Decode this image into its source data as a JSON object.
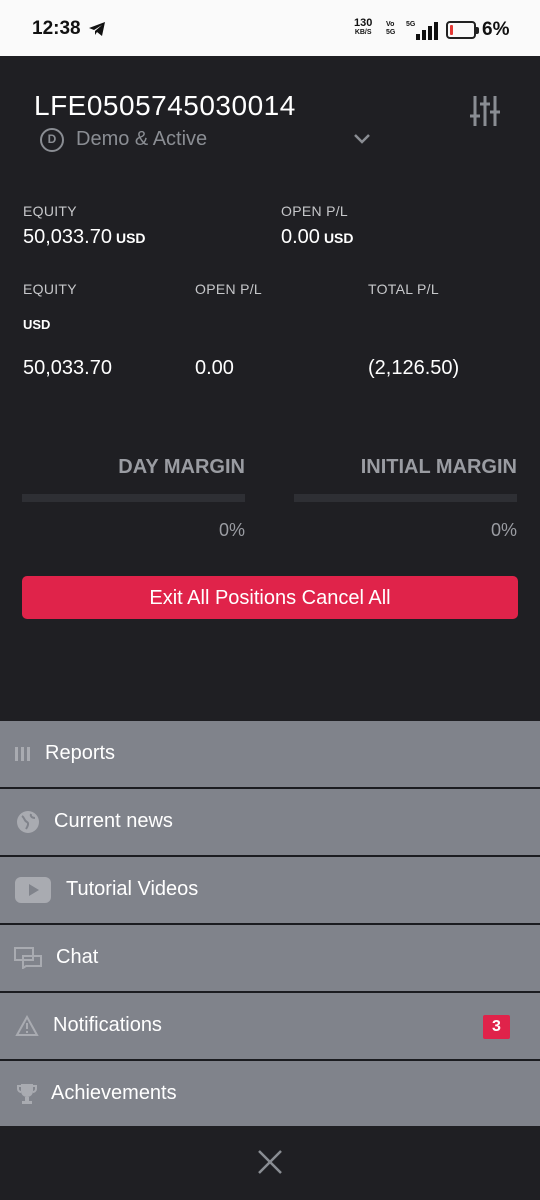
{
  "status_bar": {
    "time": "12:38",
    "net_speed": "130",
    "net_unit": "KB/S",
    "volte_top": "Vo",
    "volte_bottom": "5G",
    "network": "5G",
    "battery": "6%",
    "battery_level": 0.06
  },
  "account": {
    "id": "LFE0505745030014",
    "status": "Demo & Active",
    "status_icon_letter": "D"
  },
  "summary": {
    "equity_label": "EQUITY",
    "equity_value": "50,033.70",
    "equity_unit": "USD",
    "open_pl_label": "OPEN P/L",
    "open_pl_value": "0.00",
    "open_pl_unit": "USD"
  },
  "detail": {
    "equity_label": "EQUITY",
    "open_pl_label": "OPEN P/L",
    "total_pl_label": "TOTAL P/L",
    "currency": "USD",
    "equity_value": "50,033.70",
    "open_pl_value": "0.00",
    "total_pl_value": "(2,126.50)"
  },
  "margins": {
    "day_margin_label": "DAY MARGIN",
    "day_margin_pct": "0%",
    "initial_margin_label": "INITIAL MARGIN",
    "initial_margin_pct": "0%"
  },
  "actions": {
    "exit_all_label": "Exit All Positions Cancel All",
    "exit_color": "#e0234a"
  },
  "menu": {
    "items": [
      {
        "label": "Reports",
        "icon": "reports-icon"
      },
      {
        "label": "Current news",
        "icon": "globe-icon"
      },
      {
        "label": "Tutorial Videos",
        "icon": "youtube-icon"
      },
      {
        "label": "Chat",
        "icon": "chat-icon"
      },
      {
        "label": "Notifications",
        "icon": "warning-icon",
        "badge": "3"
      },
      {
        "label": "Achievements",
        "icon": "trophy-icon"
      }
    ]
  }
}
